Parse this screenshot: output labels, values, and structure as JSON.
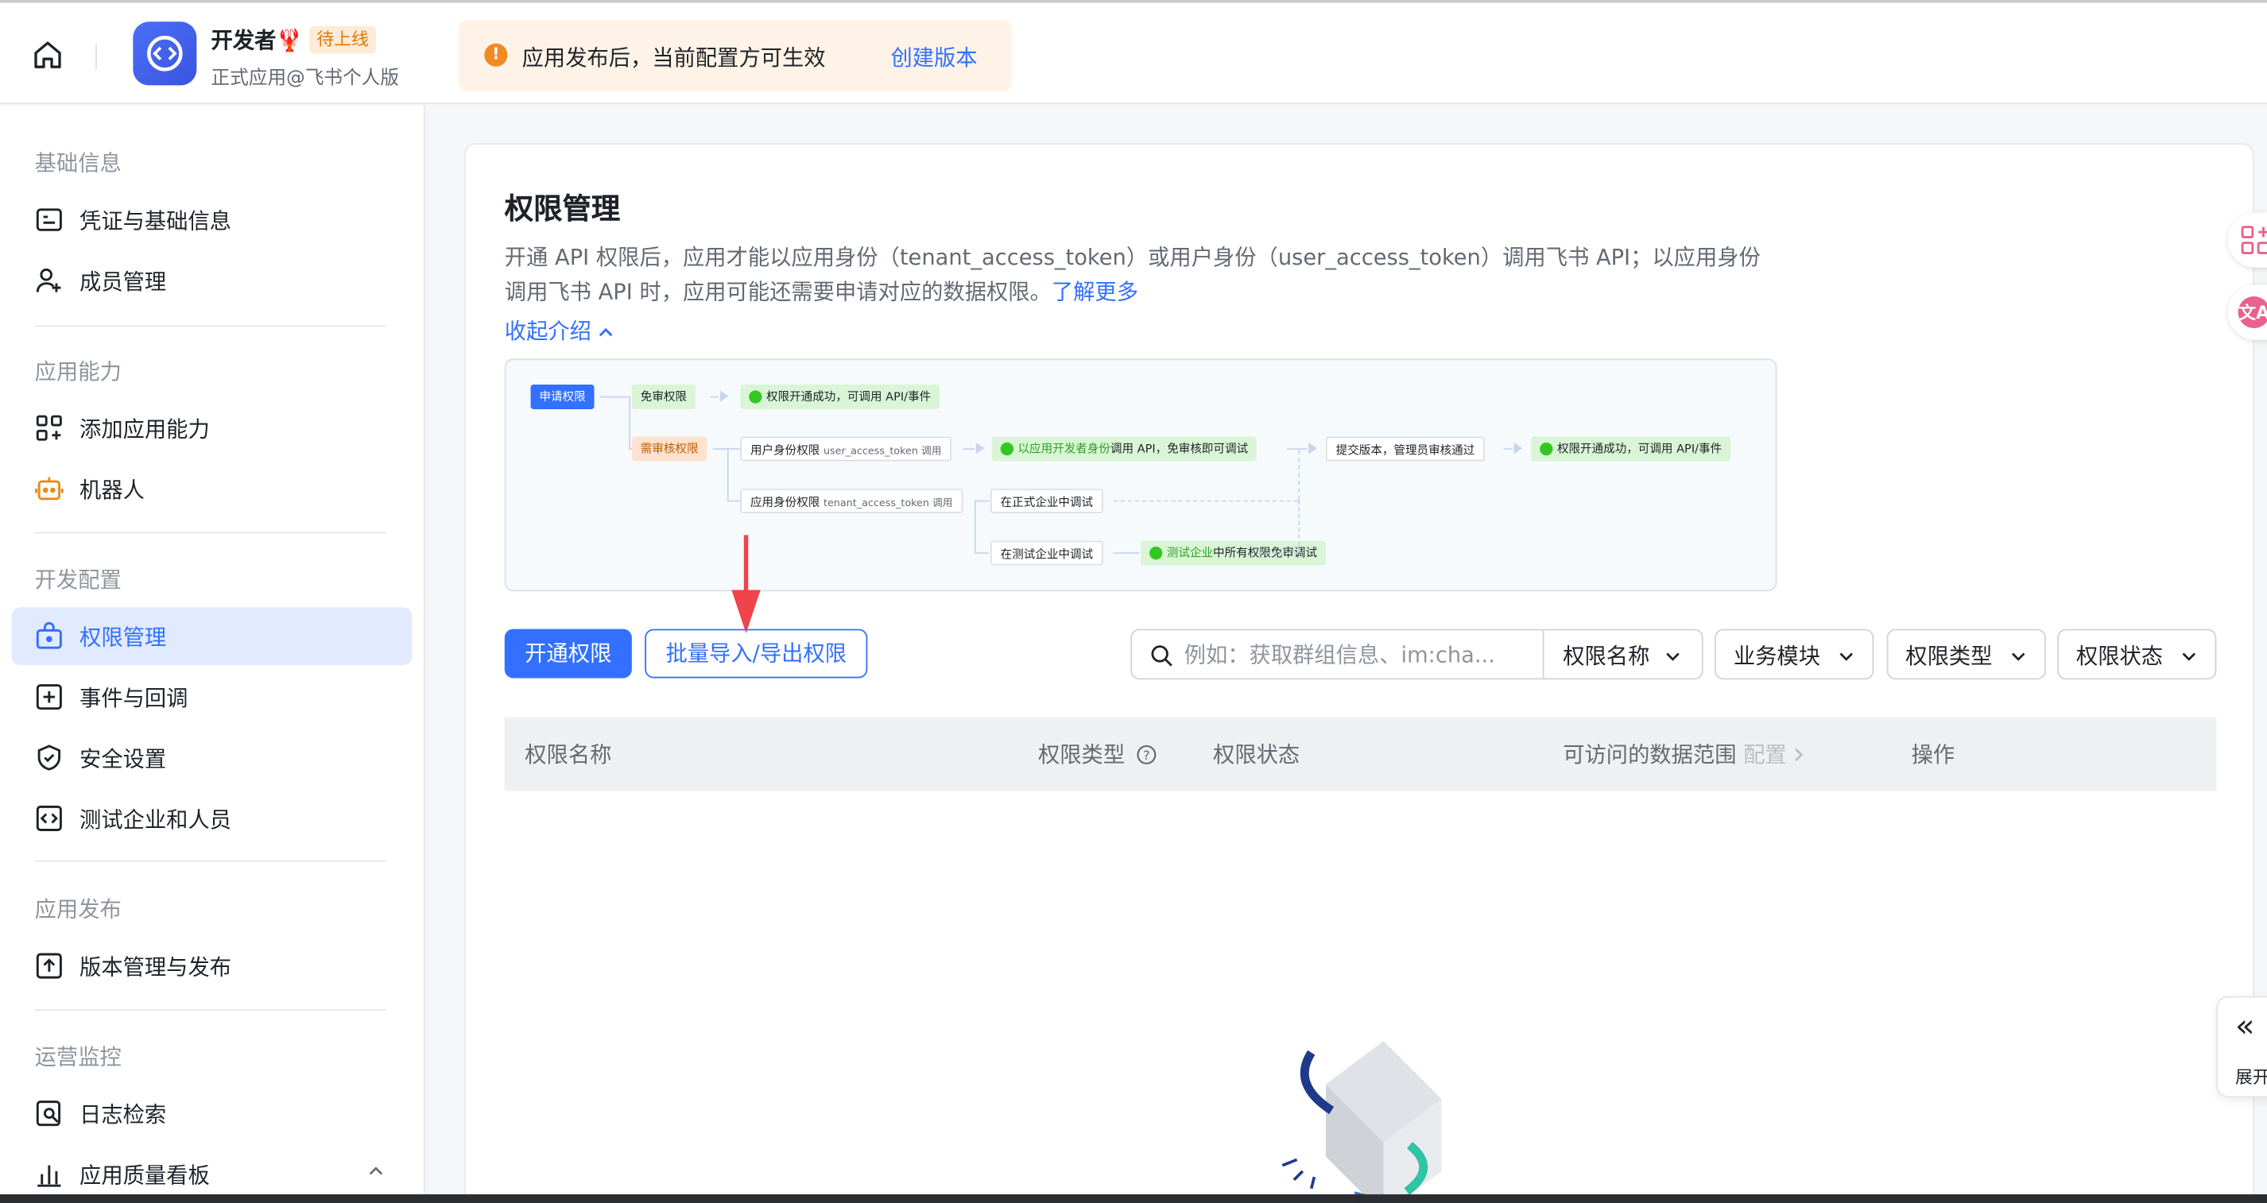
{
  "header": {
    "app_name": "开发者🦞",
    "app_badge": "待上线",
    "app_subtitle": "正式应用@飞书个人版",
    "notice_text": "应用发布后，当前配置方可生效",
    "notice_link": "创建版本"
  },
  "sidebar": {
    "groups": [
      "基础信息",
      "应用能力",
      "开发配置",
      "应用发布",
      "运营监控"
    ],
    "items": [
      {
        "label": "凭证与基础信息",
        "icon": "credential-icon"
      },
      {
        "label": "成员管理",
        "icon": "add-user-icon"
      },
      {
        "label": "添加应用能力",
        "icon": "apps-add-icon"
      },
      {
        "label": "机器人",
        "icon": "robot-icon"
      },
      {
        "label": "权限管理",
        "icon": "permission-icon",
        "active": true
      },
      {
        "label": "事件与回调",
        "icon": "event-icon"
      },
      {
        "label": "安全设置",
        "icon": "shield-icon"
      },
      {
        "label": "测试企业和人员",
        "icon": "code-icon"
      },
      {
        "label": "版本管理与发布",
        "icon": "upload-icon"
      },
      {
        "label": "日志检索",
        "icon": "log-search-icon"
      },
      {
        "label": "应用质量看板",
        "icon": "bar-chart-icon"
      }
    ]
  },
  "main": {
    "title": "权限管理",
    "desc": "开通 API 权限后，应用才能以应用身份（tenant_access_token）或用户身份（user_access_token）调用飞书 API；以应用身份调用飞书 API 时，应用可能还需要申请对应的数据权限。",
    "learn_more": "了解更多",
    "collapse": "收起介绍",
    "flow": {
      "apply": "申请权限",
      "free": "免审权限",
      "free_success": "权限开通成功，可调用 API/事件",
      "review": "需审核权限",
      "user_token": "用户身份权限",
      "user_token_sub": "user_access_token 调用",
      "tenant_token": "应用身份权限",
      "tenant_token_sub": "tenant_access_token 调用",
      "dev_call_a": "以应用开发者身份",
      "dev_call_b": "调用 API，免审核即可调试",
      "submit": "提交版本，管理员审核通过",
      "final_success": "权限开通成功，可调用 API/事件",
      "prod_debug": "在正式企业中调试",
      "test_debug": "在测试企业中调试",
      "test_all_a": "测试企业",
      "test_all_b": "中所有权限免审调试"
    },
    "btn_open": "开通权限",
    "btn_batch": "批量导入/导出权限",
    "search_placeholder": "例如：获取群组信息、im:cha...",
    "search_field": "权限名称",
    "filters": [
      "业务模块",
      "权限类型",
      "权限状态"
    ],
    "table_headers": {
      "name": "权限名称",
      "type": "权限类型",
      "status": "权限状态",
      "scope": "可访问的数据范围",
      "scope_config": "配置",
      "action": "操作"
    }
  },
  "right": {
    "expand_label": "展开"
  },
  "colors": {
    "accent": "#3370ff",
    "warning": "#f08a24",
    "active_bg": "#e1eaff"
  }
}
